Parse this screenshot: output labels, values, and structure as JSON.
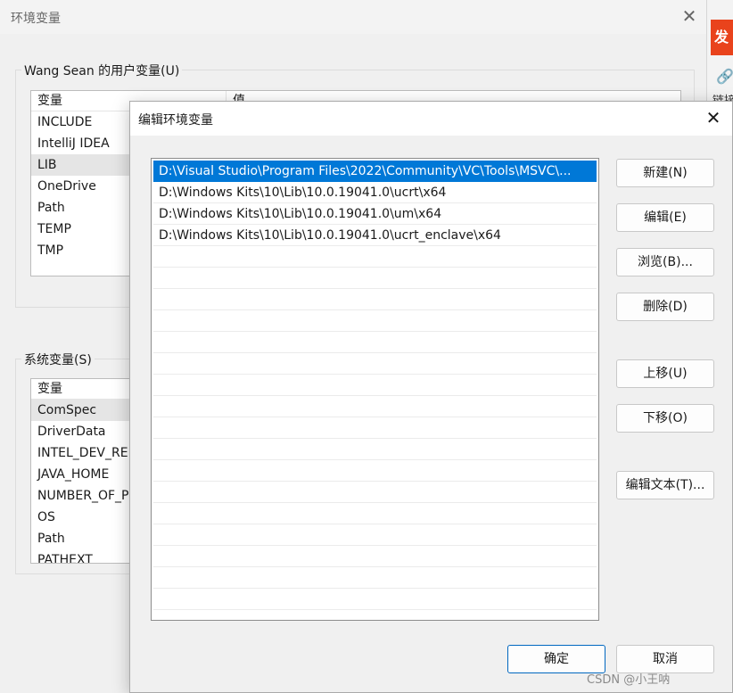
{
  "background_window": {
    "badge": "发",
    "link_text": "链接",
    "ticks": [
      "-",
      "-"
    ]
  },
  "back_dialog": {
    "title": "环境变量",
    "user_group_label": "Wang Sean 的用户变量(U)",
    "user_columns": [
      "变量",
      "值"
    ],
    "user_vars": [
      "INCLUDE",
      "IntelliJ IDEA",
      "LIB",
      "OneDrive",
      "Path",
      "TEMP",
      "TMP"
    ],
    "user_selected_index": 2,
    "system_group_label": "系统变量(S)",
    "system_columns": [
      "变量"
    ],
    "system_vars": [
      "ComSpec",
      "DriverData",
      "INTEL_DEV_RE",
      "JAVA_HOME",
      "NUMBER_OF_P",
      "OS",
      "Path",
      "PATHEXT"
    ],
    "system_selected_index": 0
  },
  "edit_dialog": {
    "title": "编辑环境变量",
    "paths": [
      "D:\\Visual Studio\\Program Files\\2022\\Community\\VC\\Tools\\MSVC\\...",
      "D:\\Windows Kits\\10\\Lib\\10.0.19041.0\\ucrt\\x64",
      "D:\\Windows Kits\\10\\Lib\\10.0.19041.0\\um\\x64",
      "D:\\Windows Kits\\10\\Lib\\10.0.19041.0\\ucrt_enclave\\x64"
    ],
    "selected_index": 0,
    "buttons": {
      "new": "新建(N)",
      "edit": "编辑(E)",
      "browse": "浏览(B)...",
      "delete": "删除(D)",
      "move_up": "上移(U)",
      "move_down": "下移(O)",
      "edit_text": "编辑文本(T)...",
      "ok": "确定",
      "cancel": "取消"
    },
    "colors": {
      "selection": "#0078d7",
      "ok_border": "#0067c0"
    }
  },
  "watermark": "CSDN @小王呐"
}
